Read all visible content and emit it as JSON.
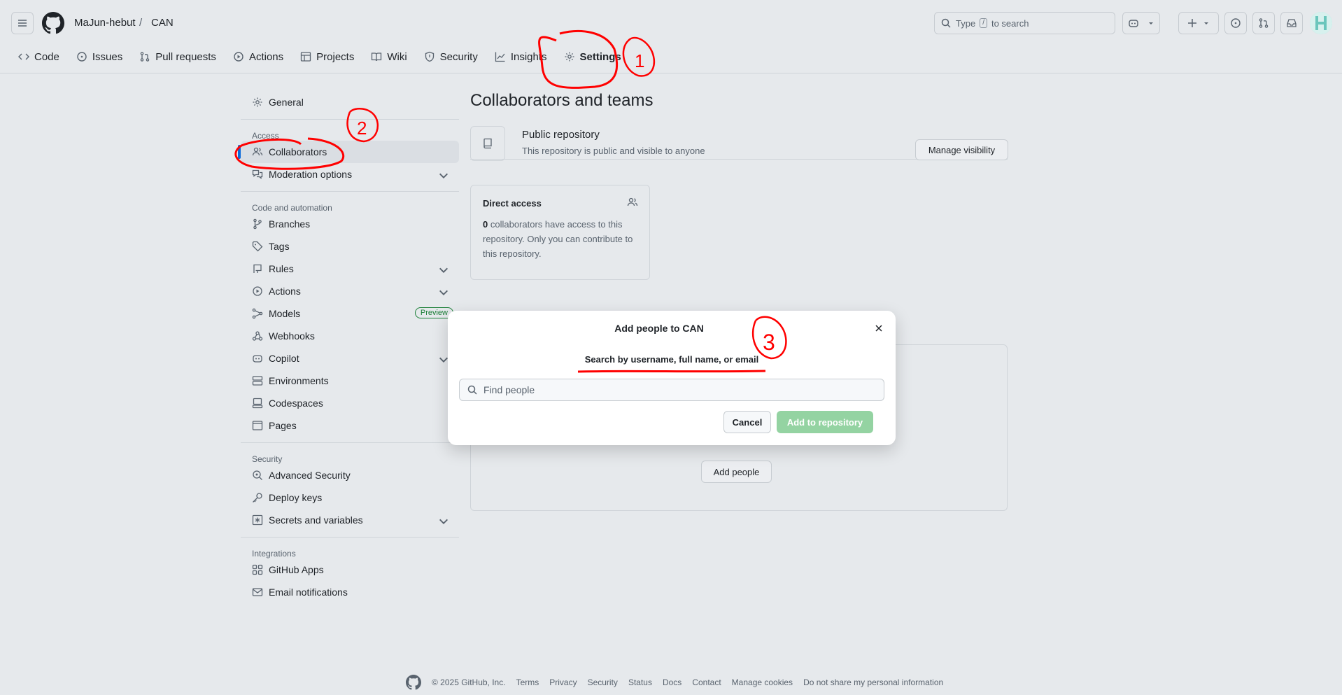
{
  "header": {
    "owner": "MaJun-hebut",
    "separator": "/",
    "repo": "CAN",
    "search_prefix": "Type",
    "search_key": "/",
    "search_suffix": "to search"
  },
  "tabs": [
    {
      "label": "Code",
      "icon": "code-icon"
    },
    {
      "label": "Issues",
      "icon": "issue-icon"
    },
    {
      "label": "Pull requests",
      "icon": "pull-request-icon"
    },
    {
      "label": "Actions",
      "icon": "play-icon"
    },
    {
      "label": "Projects",
      "icon": "table-icon"
    },
    {
      "label": "Wiki",
      "icon": "book-icon"
    },
    {
      "label": "Security",
      "icon": "shield-icon"
    },
    {
      "label": "Insights",
      "icon": "graph-icon"
    },
    {
      "label": "Settings",
      "icon": "gear-icon",
      "active": true
    }
  ],
  "sidebar": {
    "general": "General",
    "access_heading": "Access",
    "collaborators": "Collaborators",
    "moderation": "Moderation options",
    "code_heading": "Code and automation",
    "branches": "Branches",
    "tags": "Tags",
    "rules": "Rules",
    "actions": "Actions",
    "models": "Models",
    "models_badge": "Preview",
    "webhooks": "Webhooks",
    "copilot": "Copilot",
    "environments": "Environments",
    "codespaces": "Codespaces",
    "pages": "Pages",
    "security_heading": "Security",
    "advanced_security": "Advanced Security",
    "deploy_keys": "Deploy keys",
    "secrets": "Secrets and variables",
    "integrations_heading": "Integrations",
    "github_apps": "GitHub Apps",
    "email_notifications": "Email notifications"
  },
  "main": {
    "title": "Collaborators and teams",
    "public_title": "Public repository",
    "public_sub": "This repository is public and visible to anyone",
    "manage_visibility": "Manage visibility",
    "direct_access": "Direct access",
    "direct_count": "0",
    "direct_text": "collaborators have access to this repository. Only you can contribute to this repository.",
    "add_people": "Add people"
  },
  "modal": {
    "title": "Add people to CAN",
    "label": "Search by username, full name, or email",
    "placeholder": "Find people",
    "cancel": "Cancel",
    "add": "Add to repository"
  },
  "footer": {
    "copyright": "© 2025 GitHub, Inc.",
    "links": [
      "Terms",
      "Privacy",
      "Security",
      "Status",
      "Docs",
      "Contact",
      "Manage cookies",
      "Do not share my personal information"
    ]
  },
  "annotations": {
    "step1": "1",
    "step2": "2",
    "step3": "3"
  },
  "colors": {
    "annotation": "#ff0000",
    "accent": "#0969da",
    "primary_disabled": "#94d3a2"
  }
}
